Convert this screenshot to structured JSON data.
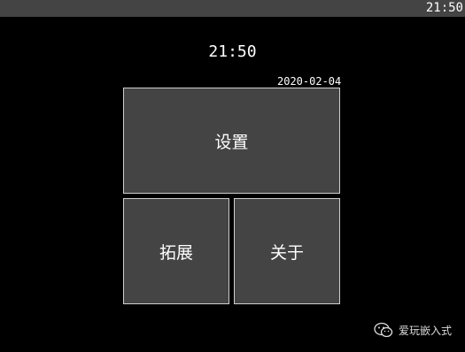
{
  "statusbar": {
    "time": "21:50"
  },
  "clock": {
    "time": "21:50"
  },
  "date": "2020-02-04",
  "tiles": {
    "settings": "设置",
    "extend": "拓展",
    "about": "关于"
  },
  "watermark": {
    "text": "爱玩嵌入式",
    "icon": "wechat-logo-icon"
  }
}
